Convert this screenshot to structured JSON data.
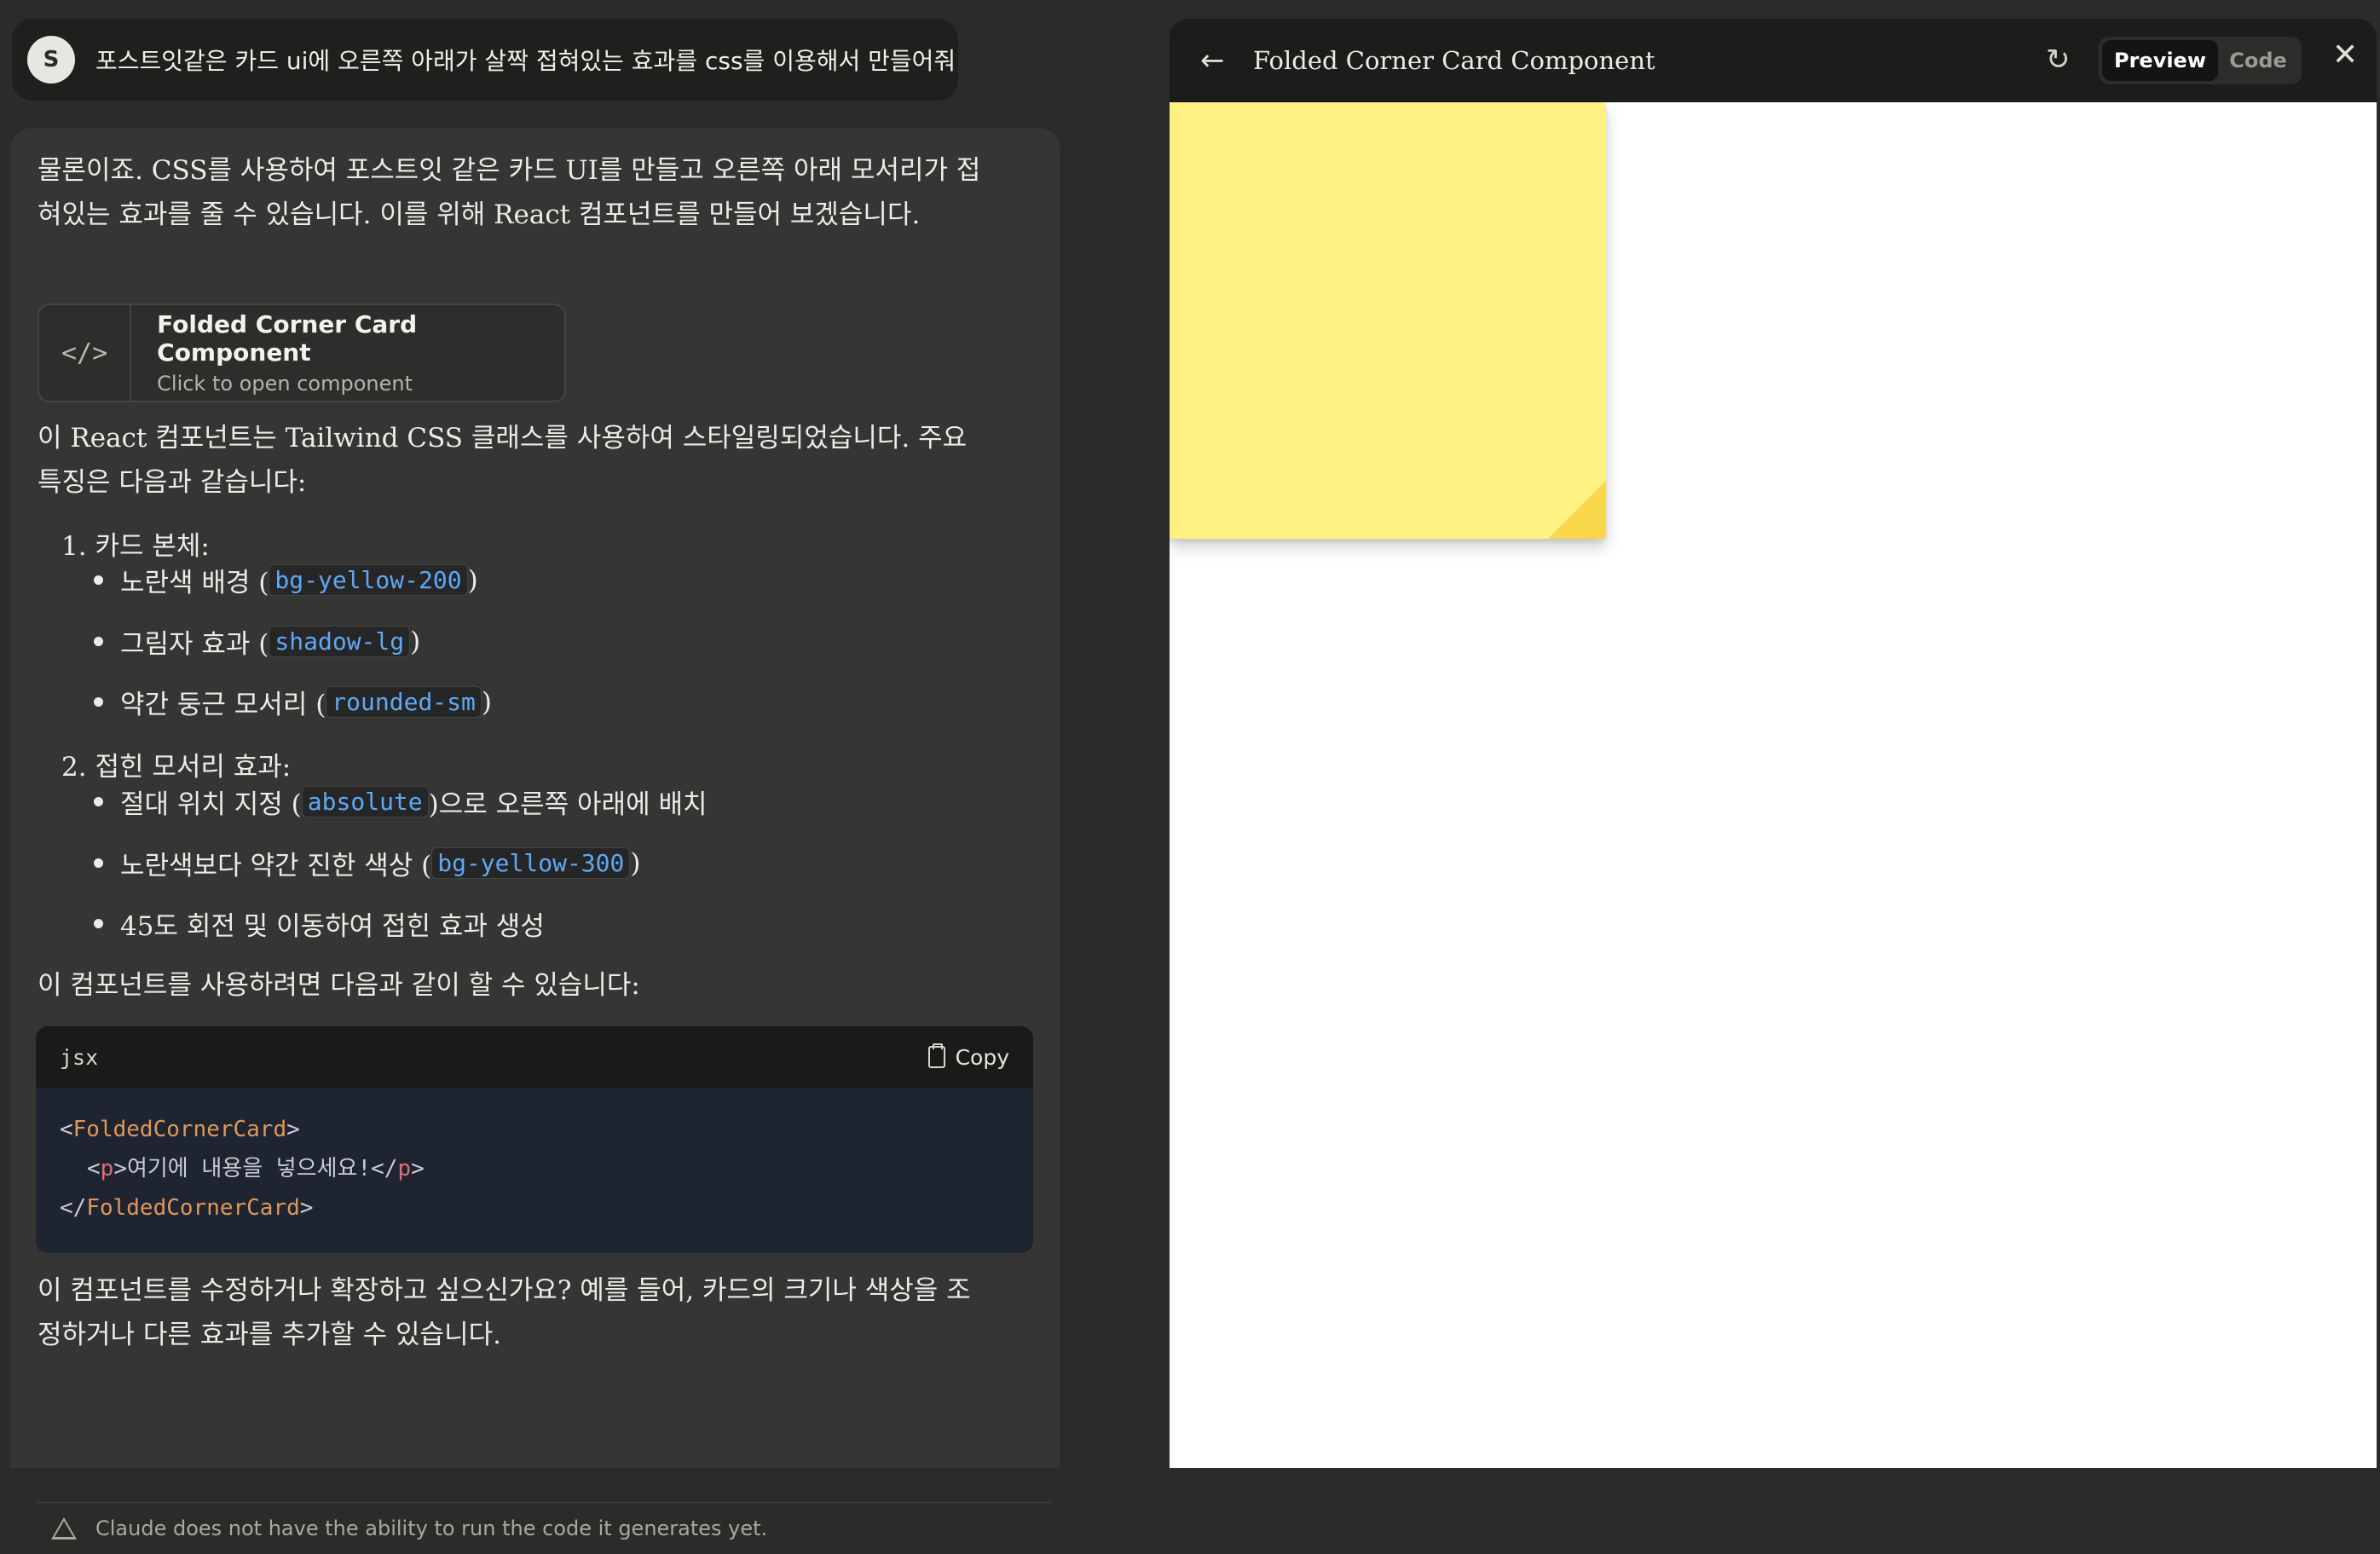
{
  "user_message": {
    "avatar_initial": "S",
    "text": "포스트잇같은 카드 ui에 오른쪽 아래가 살짝 접혀있는 효과를 css를 이용해서 만들어줘"
  },
  "assistant": {
    "intro": "물론이죠. CSS를 사용하여 포스트잇 같은 카드 UI를 만들고 오른쪽 아래 모서리가 접혀있는 효과를 줄 수 있습니다. 이를 위해 React 컴포넌트를 만들어 보겠습니다.",
    "artifact": {
      "icon": "</>",
      "title": "Folded Corner Card Component",
      "subtitle": "Click to open component"
    },
    "features_intro": "이 React 컴포넌트는 Tailwind CSS 클래스를 사용하여 스타일링되었습니다. 주요 특징은 다음과 같습니다:",
    "list": [
      {
        "number": "1.",
        "heading": "카드 본체:",
        "items": [
          {
            "before": "노란색 배경 (",
            "code": "bg-yellow-200",
            "after": ")"
          },
          {
            "before": "그림자 효과 (",
            "code": "shadow-lg",
            "after": ")"
          },
          {
            "before": "약간 둥근 모서리 (",
            "code": "rounded-sm",
            "after": ")"
          }
        ]
      },
      {
        "number": "2.",
        "heading": "접힌 모서리 효과:",
        "items": [
          {
            "before": "절대 위치 지정 (",
            "code": "absolute",
            "after": ")으로 오른쪽 아래에 배치"
          },
          {
            "before": "노란색보다 약간 진한 색상 (",
            "code": "bg-yellow-300",
            "after": ")"
          },
          {
            "before": "45도 회전 및 이동하여 접힌 효과 생성",
            "code": "",
            "after": ""
          }
        ]
      }
    ],
    "usage_intro": "이 컴포넌트를 사용하려면 다음과 같이 할 수 있습니다:",
    "code_block": {
      "language": "jsx",
      "copy_label": "Copy",
      "line1_open": "<",
      "line1_tag": "FoldedCornerCard",
      "line1_close": ">",
      "line2_open": "<",
      "line2_tag": "p",
      "line2_mid": ">여기에 내용을 넣으세요!</",
      "line2_tag_end": "p",
      "line2_close": ">",
      "line3_open": "</",
      "line3_tag": "FoldedCornerCard",
      "line3_close": ">"
    },
    "outro": "이 컴포넌트를 수정하거나 확장하고 싶으신가요? 예를 들어, 카드의 크기나 색상을 조정하거나 다른 효과를 추가할 수 있습니다.",
    "disclaimer": "Claude does not have the ability to run the code it generates yet."
  },
  "panel": {
    "back_icon": "←",
    "title": "Folded Corner Card Component",
    "refresh_icon": "↻",
    "tab_preview": "Preview",
    "tab_code": "Code",
    "close_icon": "✕",
    "card_color": "#fff082",
    "fold_color": "#f8d84a"
  }
}
